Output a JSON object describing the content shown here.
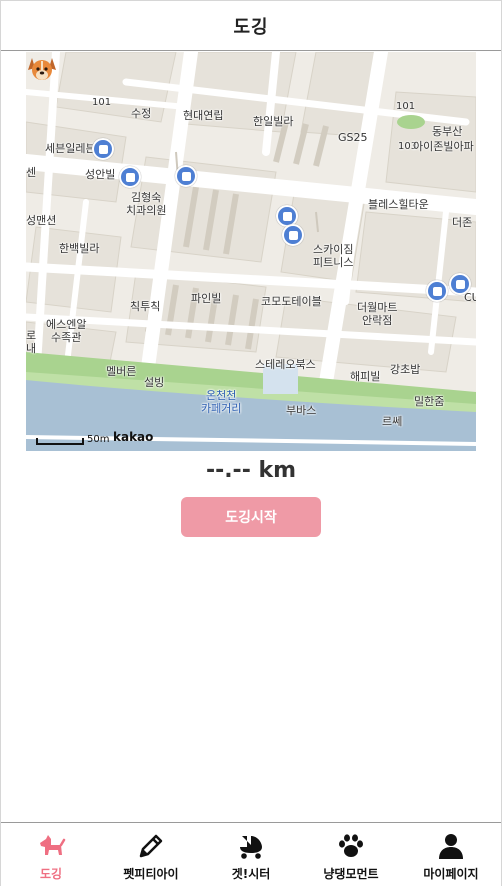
{
  "header": {
    "title": "도깅"
  },
  "map": {
    "labels": {
      "sujeong": "수정",
      "hyundae": "현대연립",
      "hanil": "한일빌라",
      "gs25": "GS25",
      "dongbusan": "동부산",
      "dongbusan2": "아이존빌아파",
      "sejong": "세븐일레븐",
      "seongan": "성안빌",
      "kim_dental": "김형숙\n치과의원",
      "blessing": "블레스힐타운",
      "seongmansun": "성맨션",
      "hanbaek": "한백빌라",
      "sky": "스카이짐\n피트니스",
      "deojeon": "더존",
      "chiktuk": "칙투칙",
      "pine": "파인빌",
      "comodo": "코모도테이블",
      "theworld": "더월마트\n안락점",
      "esen": "에스엔알\n수족관",
      "ro": "로\n내",
      "stereo": "스테레오북스",
      "happy": "해피빌",
      "ganghobab": "강초밥",
      "melbun": "멜버른",
      "seolbing": "설빙",
      "oncheon": "온천천\n카페거리",
      "bubas": "부바스",
      "milhan": "밀한줌",
      "reze": "르쎄",
      "num101a": "101",
      "num101b": "101",
      "num103": "103",
      "cu": "CU",
      "sun": "센"
    },
    "scale_label": "50m",
    "brand": "kakao"
  },
  "distance": {
    "value": "--.-- km"
  },
  "start_button": {
    "label": "도깅시작"
  },
  "tabs": [
    {
      "label": "도깅",
      "icon": "dog-icon",
      "active": true
    },
    {
      "label": "펫피티아이",
      "icon": "pencil-icon",
      "active": false
    },
    {
      "label": "겟!시터",
      "icon": "stroller-icon",
      "active": false
    },
    {
      "label": "냥댕모먼트",
      "icon": "paw-icon",
      "active": false
    },
    {
      "label": "마이페이지",
      "icon": "person-icon",
      "active": false
    }
  ],
  "colors": {
    "accent": "#ef6f82",
    "button": "#ef9aa6",
    "river": "#a8c0d4",
    "park": "#a9d38f",
    "bus": "#4e7fd3"
  }
}
